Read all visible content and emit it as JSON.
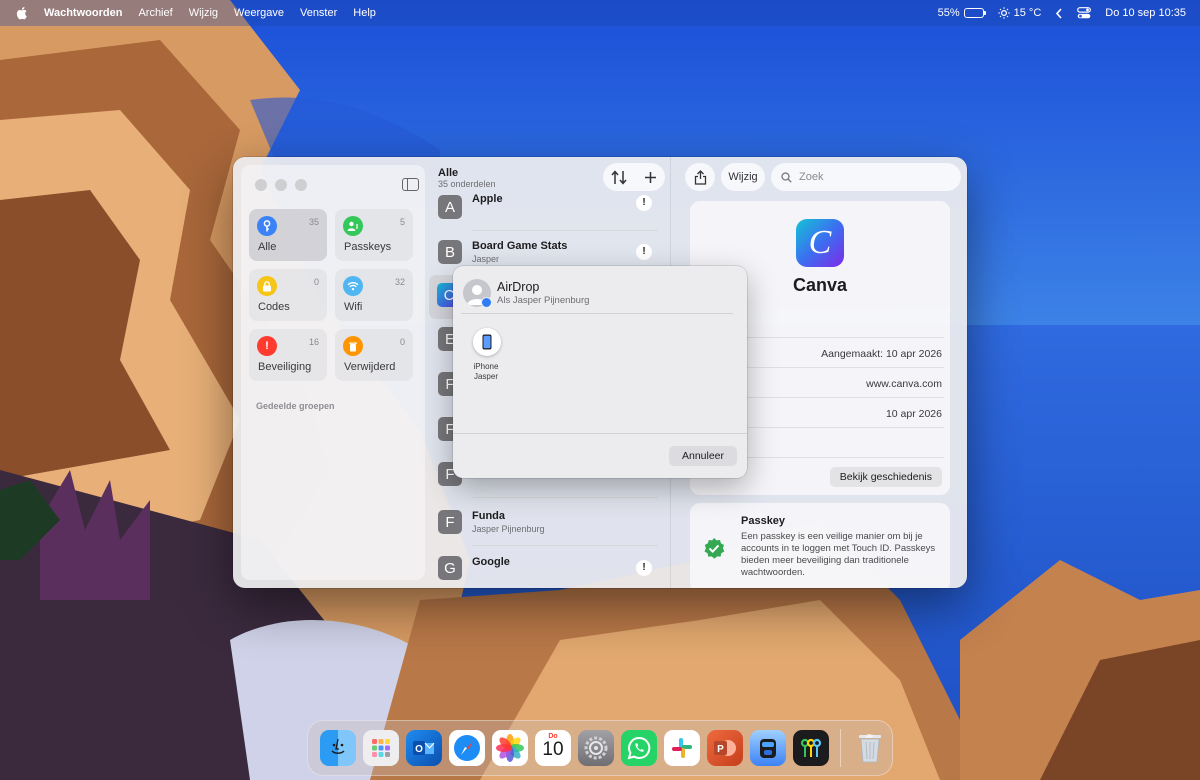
{
  "menubar": {
    "app_name": "Wachtwoorden",
    "menus": [
      "Archief",
      "Wijzig",
      "Weergave",
      "Venster",
      "Help"
    ],
    "battery": "55%",
    "battery_level": 0.55,
    "temperature": "15 °C",
    "datetime": "Do 10 sep  10:35"
  },
  "sidebar": {
    "categories": [
      {
        "label": "Alle",
        "count": "35",
        "color": "#3b82f6",
        "icon": "key-icon"
      },
      {
        "label": "Passkeys",
        "count": "5",
        "color": "#34c759",
        "icon": "person-key-icon"
      },
      {
        "label": "Codes",
        "count": "0",
        "color": "#f5c518",
        "icon": "lock-clock-icon"
      },
      {
        "label": "Wifi",
        "count": "32",
        "color": "#4fb6f2",
        "icon": "wifi-icon"
      },
      {
        "label": "Beveiliging",
        "count": "16",
        "color": "#ff3b30",
        "icon": "exclamation-icon"
      },
      {
        "label": "Verwijderd",
        "count": "0",
        "color": "#ff9500",
        "icon": "trash-icon"
      }
    ],
    "section_label": "Gedeelde groepen"
  },
  "list": {
    "title": "Alle",
    "subtitle": "35 onderdelen",
    "rows": [
      {
        "letter": "A",
        "title": "Apple",
        "sub": "",
        "warn": "!"
      },
      {
        "letter": "B",
        "title": "Board Game Stats",
        "sub": "Jasper",
        "warn": "!"
      },
      {
        "letter": "C",
        "title": "",
        "sub": "",
        "warn": ""
      },
      {
        "letter": "E",
        "title": "",
        "sub": "",
        "warn": ""
      },
      {
        "letter": "F",
        "title": "",
        "sub": "",
        "warn": ""
      },
      {
        "letter": "F",
        "title": "",
        "sub": "",
        "warn": ""
      },
      {
        "letter": "F",
        "title": "",
        "sub": "",
        "warn": ""
      },
      {
        "letter": "F",
        "title": "Funda",
        "sub": "Jasper Pijnenburg",
        "warn": ""
      },
      {
        "letter": "G",
        "title": "Google",
        "sub": "",
        "warn": "!"
      }
    ]
  },
  "detail": {
    "edit_label": "Wijzig",
    "search_placeholder": "Zoek",
    "name": "Canva",
    "logo_letter": "C",
    "lines": [
      {
        "label": "snaam",
        "value": ""
      },
      {
        "label": "",
        "value": "Aangemaakt: 10 apr 2026"
      },
      {
        "label": "",
        "value": "www.canva.com"
      },
      {
        "label": "",
        "value": "10 apr 2026"
      }
    ],
    "history_button": "Bekijk geschiedenis",
    "passkey_title": "Passkey",
    "passkey_desc": "Een passkey is een veilige manier om bij je accounts in te loggen met Touch ID. Passkeys bieden meer beveiliging dan traditionele wachtwoorden."
  },
  "airdrop": {
    "title": "AirDrop",
    "subtitle": "Als Jasper Pijnenburg",
    "device_name": "iPhone\nJasper",
    "cancel": "Annuleer"
  },
  "dock": {
    "apps": [
      {
        "name": "finder",
        "color": "#1e88f0"
      },
      {
        "name": "launchpad",
        "color": "#e8e8ea"
      },
      {
        "name": "outlook",
        "color": "#0a64c8"
      },
      {
        "name": "safari",
        "color": "#1d8cf0"
      },
      {
        "name": "photos",
        "color": "#ffffff"
      },
      {
        "name": "calendar",
        "color": "#ffffff",
        "label": "10",
        "month": "Do"
      },
      {
        "name": "settings",
        "color": "#8e8e93"
      },
      {
        "name": "whatsapp",
        "color": "#25d366"
      },
      {
        "name": "slack",
        "color": "#ffffff"
      },
      {
        "name": "powerpoint",
        "color": "#d24726"
      },
      {
        "name": "bitwarden",
        "color": "#3b82f6"
      },
      {
        "name": "passwords",
        "color": "#1c1c1e"
      },
      {
        "name": "trash",
        "color": "#d0d6dc"
      }
    ]
  }
}
